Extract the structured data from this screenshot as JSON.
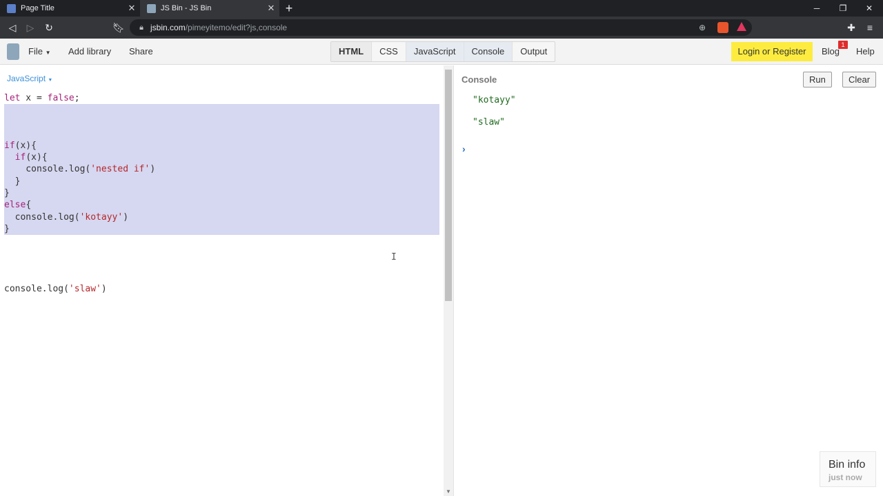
{
  "browser": {
    "tabs": [
      {
        "title": "Page Title",
        "active": false
      },
      {
        "title": "JS Bin - JS Bin",
        "active": true
      }
    ],
    "url_host": "jsbin.com",
    "url_path": "/pimeyitemo/edit?js,console"
  },
  "toolbar": {
    "file_label": "File",
    "add_library_label": "Add library",
    "share_label": "Share",
    "panels": [
      "HTML",
      "CSS",
      "JavaScript",
      "Console",
      "Output"
    ],
    "login_label": "Login or Register",
    "blog_label": "Blog",
    "blog_badge": "1",
    "help_label": "Help"
  },
  "editor": {
    "language_label": "JavaScript",
    "lines": [
      "let x = false;",
      "",
      "",
      "",
      "if(x){",
      "  if(x){",
      "    console.log('nested if')",
      "  }",
      "}",
      "else{",
      "  console.log('kotayy')",
      "}",
      "",
      "",
      "",
      "",
      "console.log('slaw')"
    ]
  },
  "console": {
    "title": "Console",
    "run_label": "Run",
    "clear_label": "Clear",
    "output": [
      "\"kotayy\"",
      "\"slaw\""
    ],
    "prompt_symbol": "›"
  },
  "bin_info": {
    "title": "Bin info",
    "subtitle": "just now"
  },
  "colors": {
    "login_bg": "#fdec3f",
    "keyword": "#a5237a",
    "string": "#b4272b",
    "selection": "#d6d7f0",
    "console_string": "#1f6a1f"
  }
}
